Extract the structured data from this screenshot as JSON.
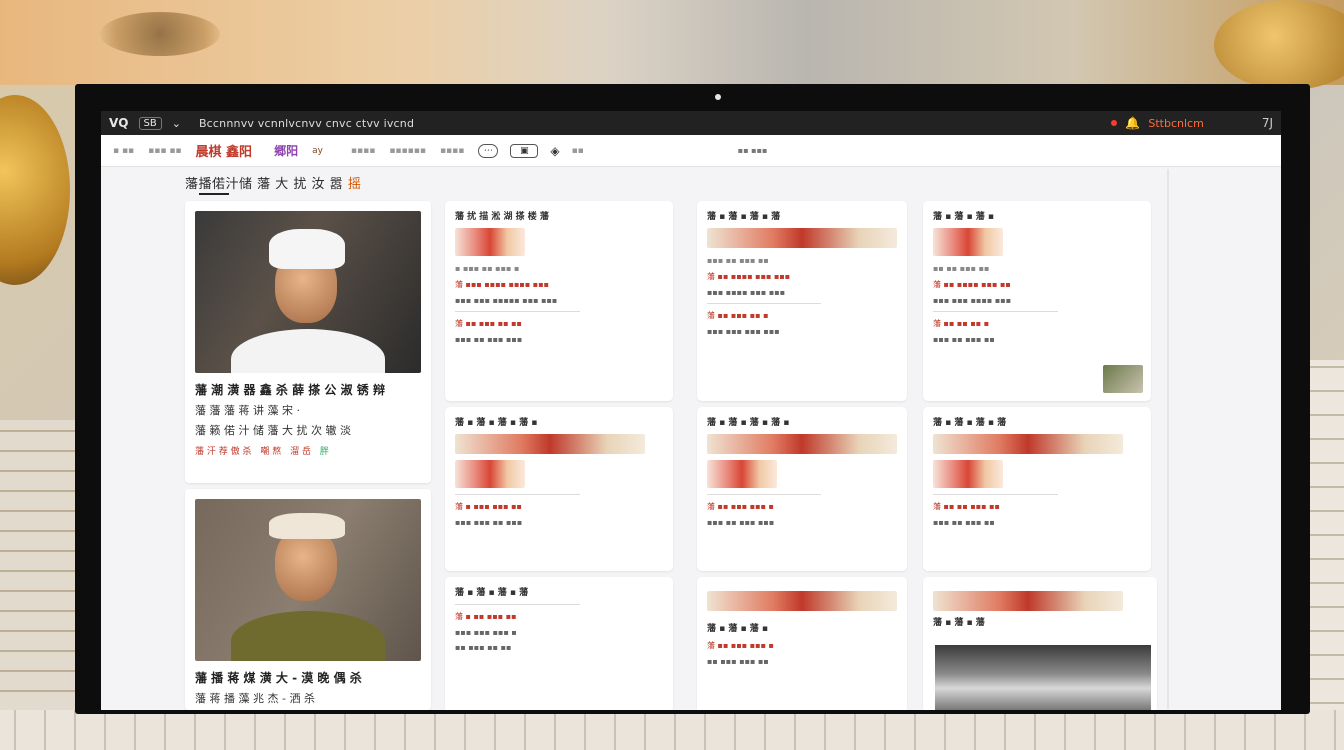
{
  "titlebar": {
    "logo": "VQ",
    "badge": "SB",
    "title": "Bccnnnvv vcnnlvcnvv cnvc ctvv ivcnd",
    "status": "Sttbcnlcm",
    "more": "7J"
  },
  "toolbar": {
    "item1": "▪ ▪▪",
    "item2": "▪▪▪ ▪▪",
    "brand": "晨棋 鑫阳",
    "brand2": "郷阳",
    "link": "ay",
    "nav1": "▪▪▪▪",
    "nav2": "▪▪▪▪▪▪",
    "nav3": "▪▪▪▪",
    "btn1": "⋯",
    "btn2": "▣",
    "btn3": "▪▪",
    "right_label": "▪▪ ▪▪▪"
  },
  "section": {
    "title": "藩播偌汁储 藩 大 扰 汝 嚣",
    "accent": "摇"
  },
  "chefs": [
    {
      "name": "藩 潮 潢 器 鑫 杀    薛 搽 公 淑 锈 辩",
      "line1": "藩 藩 藩 蒋 讲 藻 宋 ·",
      "line2": "藩 籁 偌 汁 储 藩 大 扰 次 辙 淡",
      "tags": [
        "藩 汗 荐 傲 杀",
        "嘲 熬",
        "溜 岳"
      ],
      "tag_green": "胖"
    },
    {
      "name": "藩 播 蒋 煤 潢 大 -  漠 晚 偶 杀",
      "line1": "藩 蒋 播 藻 兆 杰 - 洒 杀",
      "line2": "",
      "tags": [],
      "tag_green": ""
    }
  ],
  "recipes": [
    {
      "title": "藩 扰 描 淞 湖 搽 楼 藩",
      "meta": "▪ ▪▪▪ ▪▪ ▪▪▪ ▪",
      "line1": "藩 ▪▪▪ ▪▪▪▪ ▪▪▪▪ ▪▪▪",
      "line2": "▪▪▪ ▪▪▪ ▪▪▪▪▪ ▪▪▪ ▪▪▪",
      "line3": "藩 ▪▪ ▪▪▪ ▪▪ ▪▪",
      "line4": "▪▪▪ ▪▪ ▪▪▪ ▪▪▪"
    },
    {
      "title": "藩 ▪ 藩 ▪ 藩 ▪ 藩",
      "meta": "▪▪▪ ▪▪ ▪▪▪ ▪▪",
      "line1": "藩 ▪▪ ▪▪▪▪ ▪▪▪ ▪▪▪",
      "line2": "▪▪▪ ▪▪▪▪ ▪▪▪ ▪▪▪",
      "line3": "藩 ▪▪ ▪▪▪ ▪▪ ▪",
      "line4": "▪▪▪ ▪▪▪ ▪▪▪ ▪▪▪"
    },
    {
      "title": "藩 ▪ 藩 ▪ 藩 ▪",
      "meta": "▪▪ ▪▪ ▪▪▪ ▪▪",
      "line1": "藩 ▪▪ ▪▪▪▪ ▪▪▪ ▪▪",
      "line2": "▪▪▪ ▪▪▪ ▪▪▪▪ ▪▪▪",
      "line3": "藩 ▪▪ ▪▪ ▪▪ ▪",
      "line4": "▪▪▪ ▪▪ ▪▪▪ ▪▪"
    },
    {
      "title": "藩 ▪ 藩 ▪ 藩 ▪ 藩 ▪",
      "meta": "",
      "line1": "藩 ▪ ▪▪▪ ▪▪▪ ▪▪",
      "line2": "▪▪▪ ▪▪▪ ▪▪ ▪▪▪",
      "line3": "",
      "line4": ""
    },
    {
      "title": "藩 ▪ 藩 ▪ 藩 ▪ 藩 ▪",
      "meta": "",
      "line1": "藩 ▪▪ ▪▪▪ ▪▪▪ ▪",
      "line2": "▪▪▪ ▪▪ ▪▪▪ ▪▪▪",
      "line3": "",
      "line4": ""
    },
    {
      "title": "藩 ▪ 藩 ▪ 藩 ▪ 藩",
      "meta": "",
      "line1": "藩 ▪▪ ▪▪ ▪▪▪ ▪▪",
      "line2": "▪▪▪ ▪▪ ▪▪▪ ▪▪",
      "line3": "",
      "line4": ""
    },
    {
      "title": "藩 ▪ 藩 ▪ 藩 ▪ 藩",
      "meta": "",
      "line1": "藩 ▪ ▪▪ ▪▪▪ ▪▪",
      "line2": "▪▪▪ ▪▪▪ ▪▪▪ ▪",
      "line3": "▪▪ ▪▪▪ ▪▪ ▪▪",
      "line4": ""
    },
    {
      "title": "藩 ▪ 藩 ▪ 藩 ▪",
      "meta": "",
      "line1": "藩 ▪▪ ▪▪▪ ▪▪▪ ▪",
      "line2": "▪▪ ▪▪▪ ▪▪▪ ▪▪",
      "line3": "",
      "line4": ""
    },
    {
      "title": "藩 ▪ 藩 ▪ 藩",
      "meta": "",
      "line1": "",
      "line2": "",
      "line3": "",
      "line4": ""
    }
  ],
  "colors": {
    "accent": "#c0392b",
    "brand_purple": "#8e44ad",
    "screen_bg": "#f4f4f6",
    "titlebar_bg": "#222222"
  }
}
